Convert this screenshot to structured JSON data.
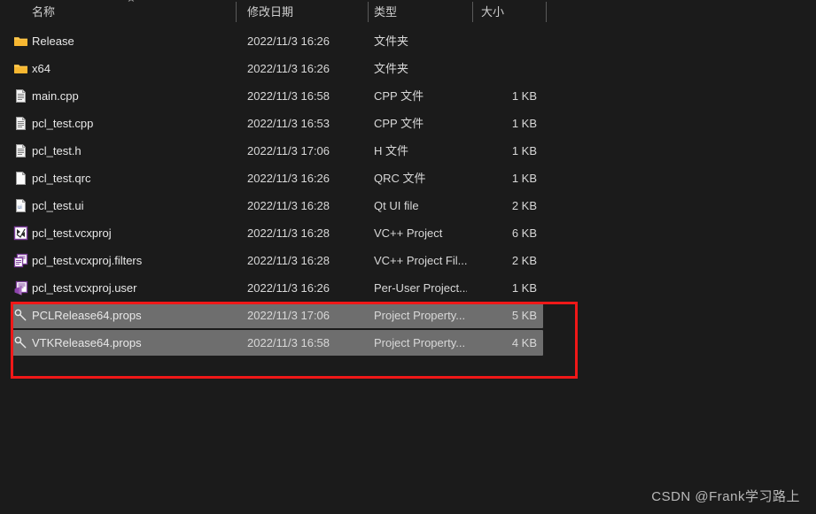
{
  "window": {
    "background_color": "#1b1b1b",
    "selection_color": "#6e6e6e",
    "annotation_color": "#f01818"
  },
  "header": {
    "sort_caret": "⌃",
    "columns": [
      {
        "label": "名称",
        "key": "name"
      },
      {
        "label": "修改日期",
        "key": "date"
      },
      {
        "label": "类型",
        "key": "type"
      },
      {
        "label": "大小",
        "key": "size"
      }
    ]
  },
  "files": [
    {
      "name": "Release",
      "date": "2022/11/3 16:26",
      "type": "文件夹",
      "size": "",
      "icon": "folder-icon",
      "selected": false
    },
    {
      "name": "x64",
      "date": "2022/11/3 16:26",
      "type": "文件夹",
      "size": "",
      "icon": "folder-icon",
      "selected": false
    },
    {
      "name": "main.cpp",
      "date": "2022/11/3 16:58",
      "type": "CPP 文件",
      "size": "1 KB",
      "icon": "text-file-icon",
      "selected": false
    },
    {
      "name": "pcl_test.cpp",
      "date": "2022/11/3 16:53",
      "type": "CPP 文件",
      "size": "1 KB",
      "icon": "text-file-icon",
      "selected": false
    },
    {
      "name": "pcl_test.h",
      "date": "2022/11/3 17:06",
      "type": "H 文件",
      "size": "1 KB",
      "icon": "text-file-icon",
      "selected": false
    },
    {
      "name": "pcl_test.qrc",
      "date": "2022/11/3 16:26",
      "type": "QRC 文件",
      "size": "1 KB",
      "icon": "blank-file-icon",
      "selected": false
    },
    {
      "name": "pcl_test.ui",
      "date": "2022/11/3 16:28",
      "type": "Qt UI file",
      "size": "2 KB",
      "icon": "qt-ui-file-icon",
      "selected": false
    },
    {
      "name": "pcl_test.vcxproj",
      "date": "2022/11/3 16:28",
      "type": "VC++ Project",
      "size": "6 KB",
      "icon": "vcxproj-icon",
      "selected": false
    },
    {
      "name": "pcl_test.vcxproj.filters",
      "date": "2022/11/3 16:28",
      "type": "VC++ Project Fil...",
      "size": "2 KB",
      "icon": "vcxproj-filters-icon",
      "selected": false
    },
    {
      "name": "pcl_test.vcxproj.user",
      "date": "2022/11/3 16:26",
      "type": "Per-User Project...",
      "size": "1 KB",
      "icon": "vcxproj-user-icon",
      "selected": false
    },
    {
      "name": "PCLRelease64.props",
      "date": "2022/11/3 17:06",
      "type": "Project Property...",
      "size": "5 KB",
      "icon": "props-wrench-icon",
      "selected": true
    },
    {
      "name": "VTKRelease64.props",
      "date": "2022/11/3 16:58",
      "type": "Project Property...",
      "size": "4 KB",
      "icon": "props-wrench-icon",
      "selected": true
    }
  ],
  "watermark": {
    "text": "CSDN @Frank学习路上"
  }
}
